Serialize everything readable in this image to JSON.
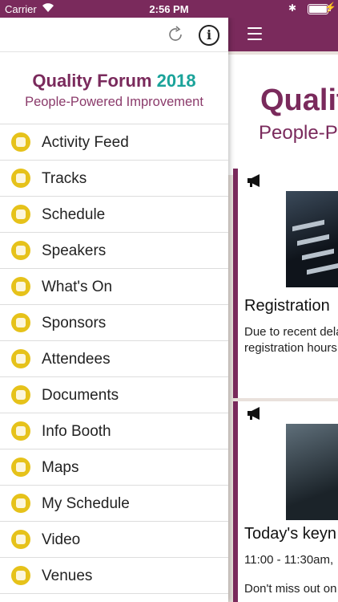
{
  "status_bar": {
    "carrier": "Carrier",
    "time": "2:56 PM"
  },
  "drawer": {
    "logo_title": "Quality Forum",
    "logo_year": "2018",
    "logo_subtitle": "People-Powered Improvement",
    "info_label": "i",
    "menu_items": [
      {
        "label": "Activity Feed",
        "icon": "chat-bubble-icon"
      },
      {
        "label": "Tracks",
        "icon": "list-icon"
      },
      {
        "label": "Schedule",
        "icon": "calendar-icon"
      },
      {
        "label": "Speakers",
        "icon": "microphone-icon"
      },
      {
        "label": "What's On",
        "icon": "clock-icon"
      },
      {
        "label": "Sponsors",
        "icon": "handshake-icon"
      },
      {
        "label": "Attendees",
        "icon": "person-icon"
      },
      {
        "label": "Documents",
        "icon": "document-icon"
      },
      {
        "label": "Info Booth",
        "icon": "info-booth-icon"
      },
      {
        "label": "Maps",
        "icon": "map-icon"
      },
      {
        "label": "My Schedule",
        "icon": "bookmark-icon"
      },
      {
        "label": "Video",
        "icon": "video-camera-icon"
      },
      {
        "label": "Venues",
        "icon": "location-pin-icon"
      }
    ]
  },
  "main": {
    "banner_title": "Qualit",
    "banner_subtitle": "People-P",
    "cards": [
      {
        "heading": "Registration",
        "body_line1": "Due to recent dela",
        "body_line2": "registration hours"
      },
      {
        "heading": "Today's keyn",
        "body_line1": "11:00 - 11:30am,",
        "body_line2": "Don't miss out on"
      }
    ]
  },
  "colors": {
    "brand": "#7a2a5c",
    "accent": "#1aa39a",
    "icon_yellow": "#e6c21a"
  }
}
